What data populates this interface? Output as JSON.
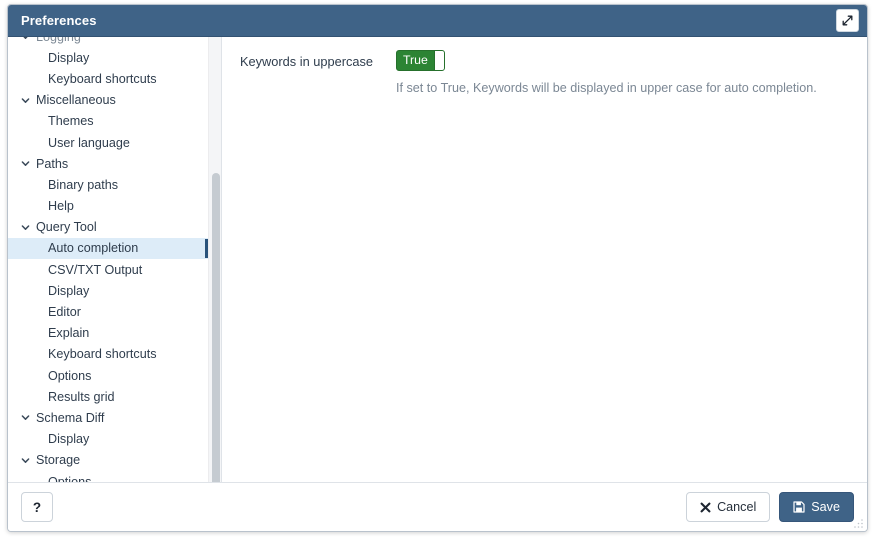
{
  "titlebar": {
    "title": "Preferences",
    "maximize_icon": "expand-diagonal-icon"
  },
  "sidebar": {
    "items": [
      {
        "label": "Logging",
        "type": "group",
        "partial": true,
        "chevron": "chevron-down-icon",
        "selected": false
      },
      {
        "label": "Display",
        "type": "leaf",
        "selected": false
      },
      {
        "label": "Keyboard shortcuts",
        "type": "leaf",
        "selected": false
      },
      {
        "label": "Miscellaneous",
        "type": "group",
        "chevron": "chevron-down-icon",
        "selected": false
      },
      {
        "label": "Themes",
        "type": "leaf",
        "selected": false
      },
      {
        "label": "User language",
        "type": "leaf",
        "selected": false
      },
      {
        "label": "Paths",
        "type": "group",
        "chevron": "chevron-down-icon",
        "selected": false
      },
      {
        "label": "Binary paths",
        "type": "leaf",
        "selected": false
      },
      {
        "label": "Help",
        "type": "leaf",
        "selected": false
      },
      {
        "label": "Query Tool",
        "type": "group",
        "chevron": "chevron-down-icon",
        "selected": false
      },
      {
        "label": "Auto completion",
        "type": "leaf",
        "selected": true
      },
      {
        "label": "CSV/TXT Output",
        "type": "leaf",
        "selected": false
      },
      {
        "label": "Display",
        "type": "leaf",
        "selected": false
      },
      {
        "label": "Editor",
        "type": "leaf",
        "selected": false
      },
      {
        "label": "Explain",
        "type": "leaf",
        "selected": false
      },
      {
        "label": "Keyboard shortcuts",
        "type": "leaf",
        "selected": false
      },
      {
        "label": "Options",
        "type": "leaf",
        "selected": false
      },
      {
        "label": "Results grid",
        "type": "leaf",
        "selected": false
      },
      {
        "label": "Schema Diff",
        "type": "group",
        "chevron": "chevron-down-icon",
        "selected": false
      },
      {
        "label": "Display",
        "type": "leaf",
        "selected": false
      },
      {
        "label": "Storage",
        "type": "group",
        "chevron": "chevron-down-icon",
        "selected": false
      },
      {
        "label": "Options",
        "type": "leaf",
        "selected": false
      }
    ]
  },
  "content": {
    "fields": [
      {
        "label": "Keywords in uppercase",
        "control_type": "toggle",
        "value": "True",
        "help": "If set to True, Keywords will be displayed in upper case for auto completion."
      }
    ]
  },
  "footer": {
    "help_label": "?",
    "cancel_label": "Cancel",
    "cancel_icon": "close-x-icon",
    "save_label": "Save",
    "save_icon": "floppy-disk-icon"
  },
  "colors": {
    "titlebar_bg": "#3f6387",
    "accent": "#3f6387",
    "toggle_on": "#2c8434",
    "selection_bg": "#ddecf8",
    "selection_marker": "#29527a",
    "help_text": "#7b8794"
  }
}
